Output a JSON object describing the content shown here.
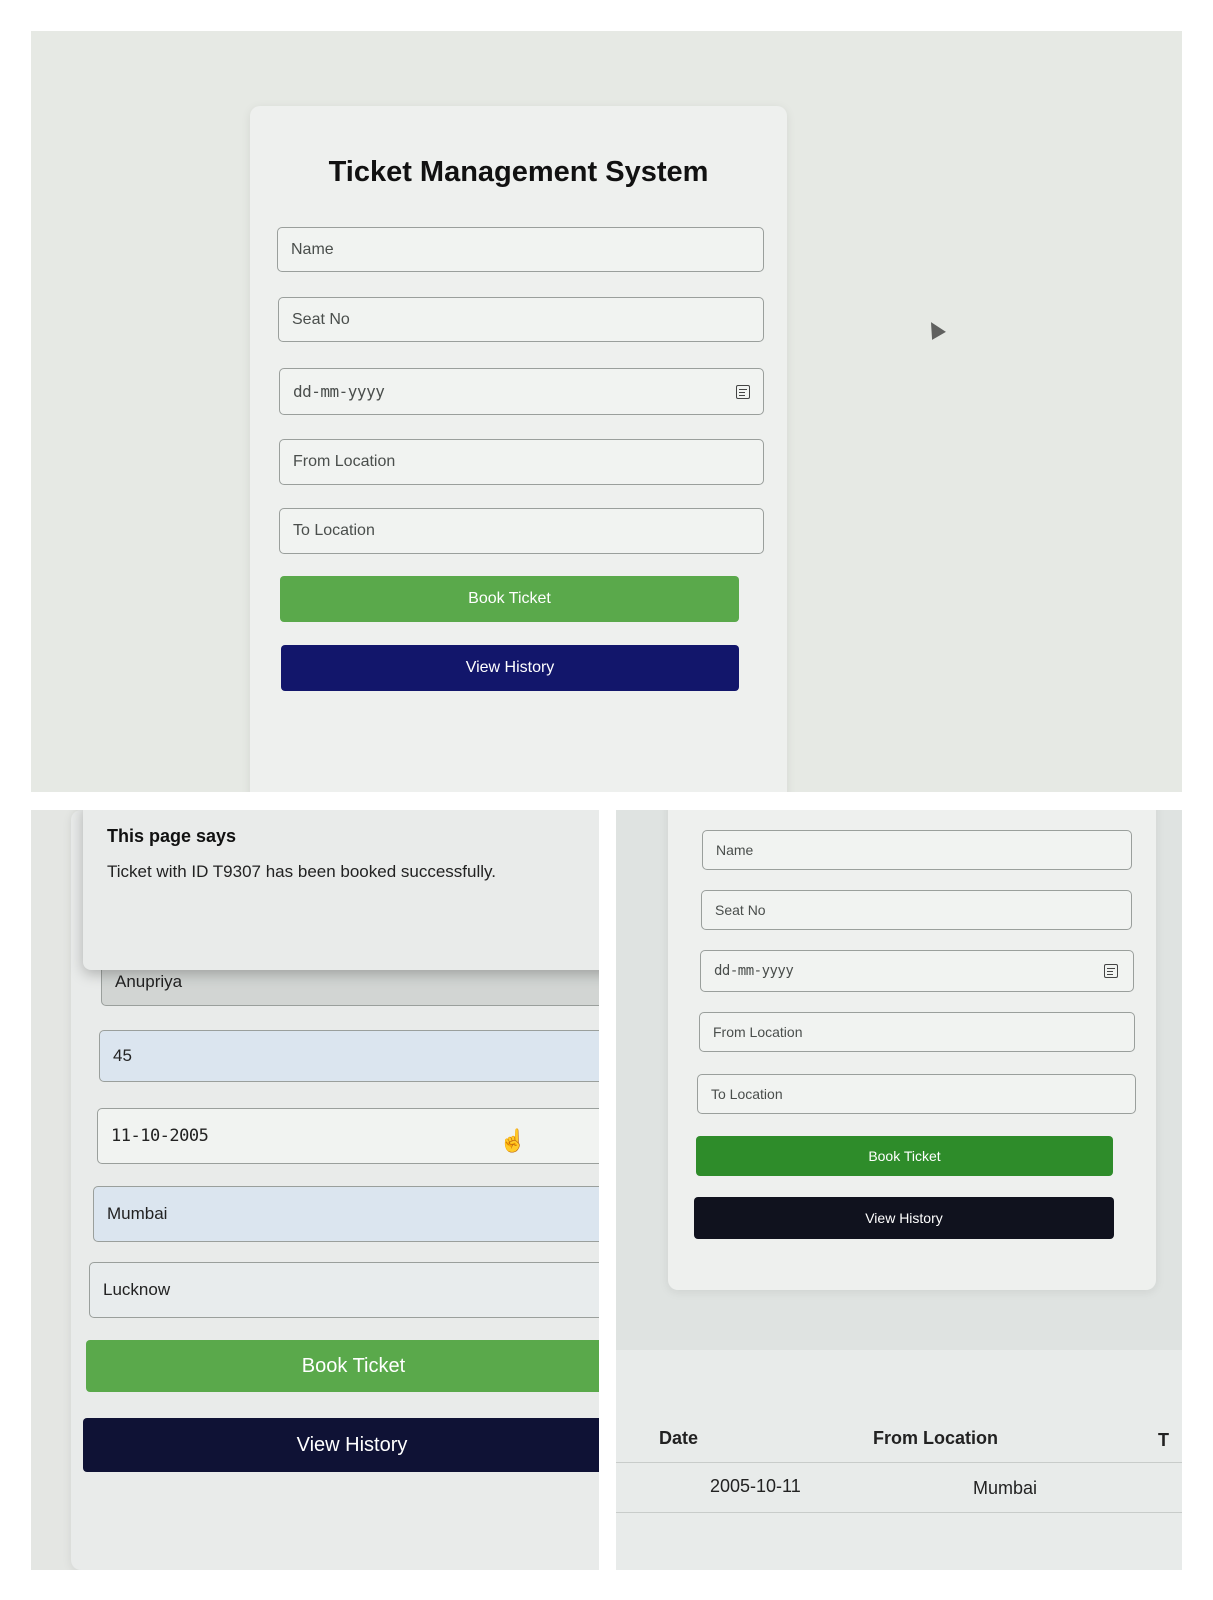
{
  "form": {
    "title": "Ticket Management System",
    "name_placeholder": "Name",
    "seat_placeholder": "Seat No",
    "date_placeholder": "dd-mm-yyyy",
    "from_placeholder": "From Location",
    "to_placeholder": "To Location",
    "book_label": "Book Ticket",
    "history_label": "View History"
  },
  "dialog": {
    "title": "This page says",
    "message": "Ticket with ID T9307 has been booked successfully."
  },
  "filled": {
    "name": "Anupriya",
    "seat": "45",
    "date": "11-10-2005",
    "from": "Mumbai",
    "to": "Lucknow"
  },
  "history": {
    "headers": [
      "Date",
      "From Location",
      "T"
    ],
    "rows": [
      {
        "date": "2005-10-11",
        "from": "Mumbai"
      }
    ]
  },
  "colors": {
    "book_button": "#5aa94b",
    "history_button": "#12166b"
  },
  "icons": [
    "calendar-icon",
    "mouse-pointer-icon",
    "hand-pointer-icon"
  ]
}
